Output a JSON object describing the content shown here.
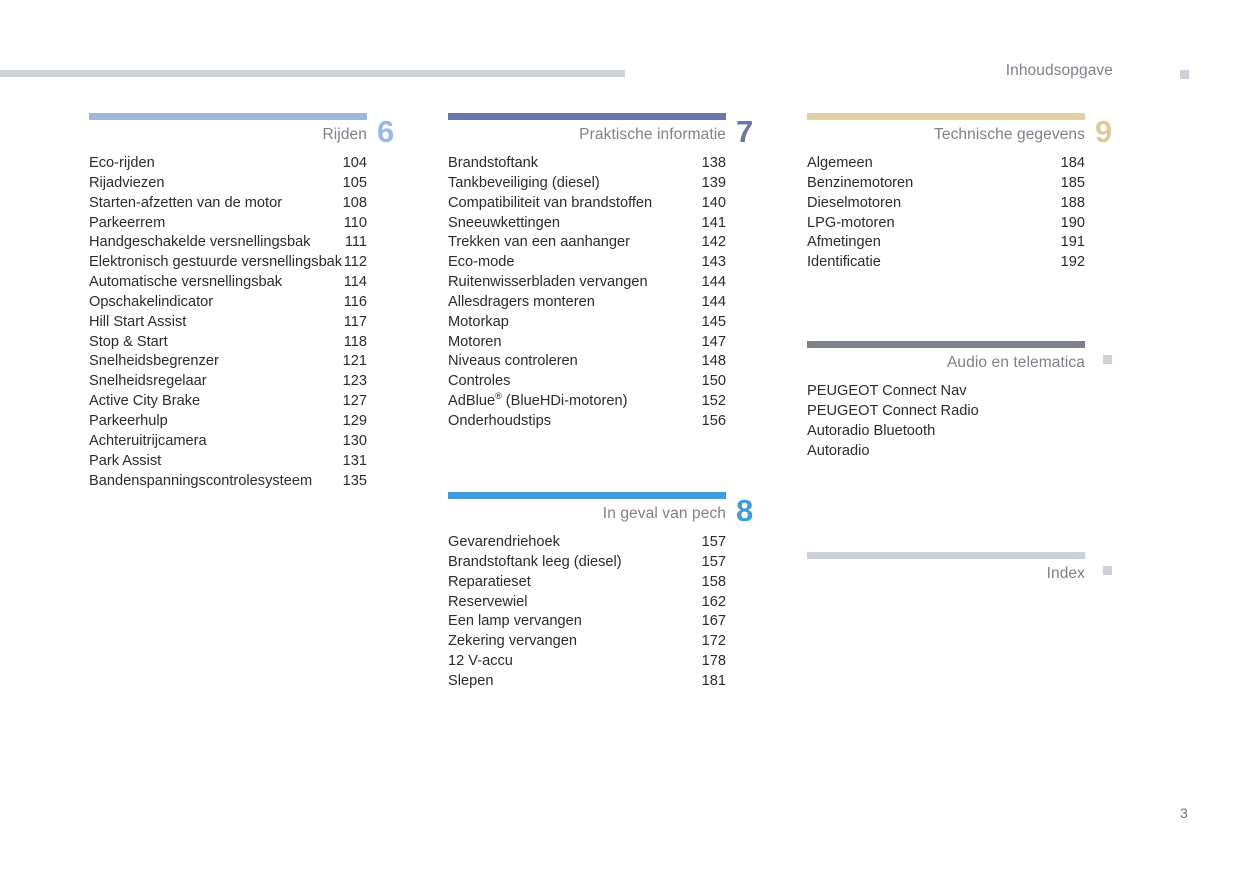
{
  "header": {
    "title": "Inhoudsopgave",
    "marker_icon": "square-marker-icon",
    "rule_color": "#ccd2d8"
  },
  "footer": {
    "page_number": "3"
  },
  "columns": [
    {
      "name": "column-left",
      "sections": [
        {
          "id": "rijden",
          "title": "Rijden",
          "number": "6",
          "color": "#9bb9dd",
          "number_color": "#9bb9dd",
          "entries": [
            {
              "label": "Eco-rijden",
              "page": "104"
            },
            {
              "label": "Rijadviezen",
              "page": "105"
            },
            {
              "label": "Starten-afzetten van de motor",
              "page": "108"
            },
            {
              "label": "Parkeerrem",
              "page": "110"
            },
            {
              "label": "Handgeschakelde versnellingsbak",
              "page": "111"
            },
            {
              "label": "Elektronisch gestuurde versnellingsbak",
              "page": "112"
            },
            {
              "label": "Automatische versnellingsbak",
              "page": "114"
            },
            {
              "label": "Opschakelindicator",
              "page": "116"
            },
            {
              "label": "Hill Start Assist",
              "page": "117"
            },
            {
              "label": "Stop & Start",
              "page": "118"
            },
            {
              "label": "Snelheidsbegrenzer",
              "page": "121"
            },
            {
              "label": "Snelheidsregelaar",
              "page": "123"
            },
            {
              "label": "Active City Brake",
              "page": "127"
            },
            {
              "label": "Parkeerhulp",
              "page": "129"
            },
            {
              "label": "Achteruitrijcamera",
              "page": "130"
            },
            {
              "label": "Park Assist",
              "page": "131"
            },
            {
              "label": "Bandenspanningscontrolesysteem",
              "page": "135"
            }
          ]
        }
      ]
    },
    {
      "name": "column-middle",
      "sections": [
        {
          "id": "praktische-informatie",
          "title": "Praktische informatie",
          "number": "7",
          "color": "#6a77a8",
          "number_color": "#6a77a8",
          "entries": [
            {
              "label": "Brandstoftank",
              "page": "138"
            },
            {
              "label": "Tankbeveiliging (diesel)",
              "page": "139"
            },
            {
              "label": "Compatibiliteit van brandstoffen",
              "page": "140"
            },
            {
              "label": "Sneeuwkettingen",
              "page": "141"
            },
            {
              "label": "Trekken van een aanhanger",
              "page": "142"
            },
            {
              "label": "Eco-mode",
              "page": "143"
            },
            {
              "label": "Ruitenwisserbladen vervangen",
              "page": "144"
            },
            {
              "label": "Allesdragers monteren",
              "page": "144"
            },
            {
              "label": "Motorkap",
              "page": "145"
            },
            {
              "label": "Motoren",
              "page": "147"
            },
            {
              "label": "Niveaus controleren",
              "page": "148"
            },
            {
              "label": "Controles",
              "page": "150"
            },
            {
              "label": "AdBlue",
              "label_sup": "®",
              "label_tail": " (BlueHDi-motoren)",
              "page": "152"
            },
            {
              "label": "Onderhoudstips",
              "page": "156"
            }
          ]
        },
        {
          "id": "in-geval-van-pech",
          "title": "In geval van pech",
          "number": "8",
          "color": "#3f9bd9",
          "number_color": "#3f9bd9",
          "entries": [
            {
              "label": "Gevarendriehoek",
              "page": "157"
            },
            {
              "label": "Brandstoftank leeg (diesel)",
              "page": "157"
            },
            {
              "label": "Reparatieset",
              "page": "158"
            },
            {
              "label": "Reservewiel",
              "page": "162"
            },
            {
              "label": "Een lamp vervangen",
              "page": "167"
            },
            {
              "label": "Zekering vervangen",
              "page": "172"
            },
            {
              "label": "12 V-accu",
              "page": "178"
            },
            {
              "label": "Slepen",
              "page": "181"
            }
          ]
        }
      ]
    },
    {
      "name": "column-right",
      "sections": [
        {
          "id": "technische-gegevens",
          "title": "Technische gegevens",
          "number": "9",
          "color": "#e0d0a2",
          "number_color": "#ddcb99",
          "entries": [
            {
              "label": "Algemeen",
              "page": "184"
            },
            {
              "label": "Benzinemotoren",
              "page": "185"
            },
            {
              "label": "Dieselmotoren",
              "page": "188"
            },
            {
              "label": "LPG-motoren",
              "page": "190"
            },
            {
              "label": "Afmetingen",
              "page": "191"
            },
            {
              "label": "Identificatie",
              "page": "192"
            }
          ]
        },
        {
          "id": "audio-en-telematica",
          "title": "Audio en telematica",
          "marker_icon": "square-marker-icon",
          "color": "#7d8288",
          "entries": [
            {
              "label": "PEUGEOT Connect Nav",
              "page": ""
            },
            {
              "label": "PEUGEOT Connect Radio",
              "page": ""
            },
            {
              "label": "Autoradio Bluetooth",
              "page": ""
            },
            {
              "label": "Autoradio",
              "page": ""
            }
          ]
        },
        {
          "id": "index",
          "title": "Index",
          "marker_icon": "square-marker-icon",
          "color": "#ccd2d8",
          "entries": []
        }
      ]
    }
  ]
}
